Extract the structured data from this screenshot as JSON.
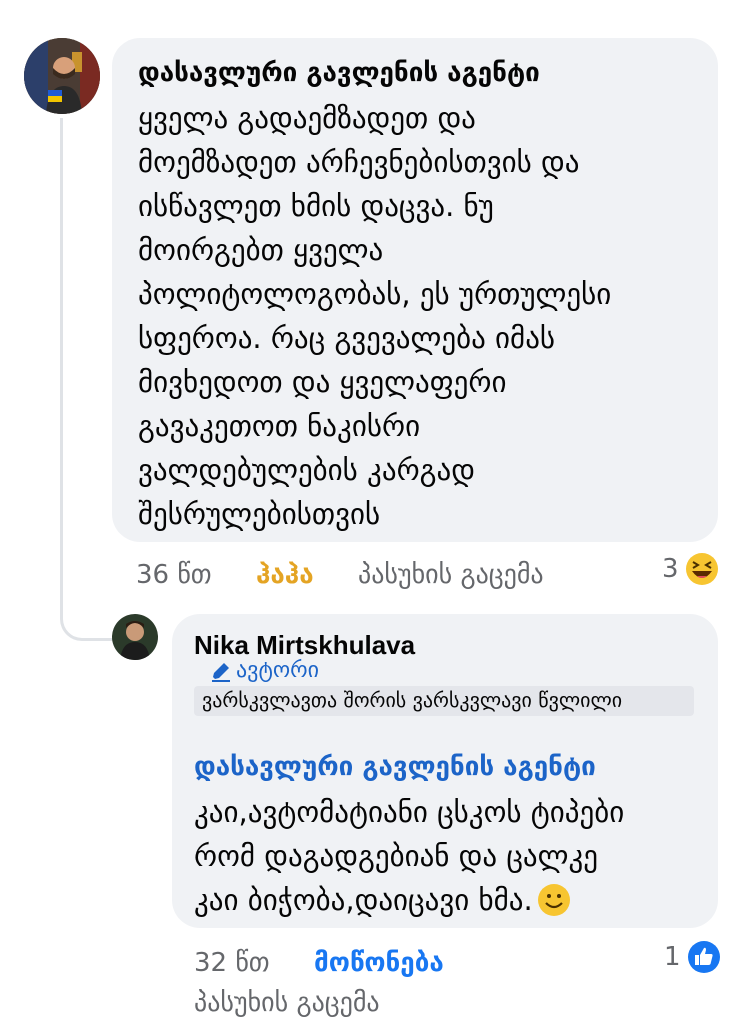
{
  "comment1": {
    "author": "დასავლური გავლენის აგენტი",
    "lines": [
      "ყველა გადაემზადეთ და",
      "მოემზადეთ  არჩევნებისთვის და",
      "ისწავლეთ ხმის დაცვა. ნუ",
      "მოირგებთ ყველა",
      "პოლიტოლოგობას, ეს ურთულესი",
      "სფეროა. რაც გვევალება იმას",
      "მივხედოთ და ყველაფერი",
      "გავაკეთოთ ნაკისრი",
      "ვალდებულების კარგად",
      "შესრულებისთვის"
    ],
    "time": "36 წთ",
    "reaction_label": "ჰაჰა",
    "reply_label": "პასუხის გაცემა",
    "reaction_count": "3",
    "reaction_icon": "haha-emoji-icon"
  },
  "reply": {
    "author": "Nika Mirtskhulava",
    "badge": "ავტორი",
    "badge_icon": "pencil-icon",
    "subtitle": "ვარსკვლავთა შორის ვარსკვლავი წვლილი",
    "mention": "დასავლური გავლენის აგენტი",
    "lines": [
      "კაი,ავტომატიანი ცსკოს ტიპები",
      "რომ დაგადგებიან და ცალკე",
      "კაი ბიჭობა,დაიცავი ხმა."
    ],
    "inline_emoji": "smile-emoji-icon",
    "time": "32 წთ",
    "like_label": "მოწონება",
    "reply_label": "პასუხის გაცემა",
    "reaction_count": "1",
    "reaction_icon": "like-thumb-icon"
  },
  "colors": {
    "bubble": "#f0f2f5",
    "meta": "#65676b",
    "haha": "#e4a424",
    "link": "#1877f2",
    "mention": "#1c64c8"
  }
}
